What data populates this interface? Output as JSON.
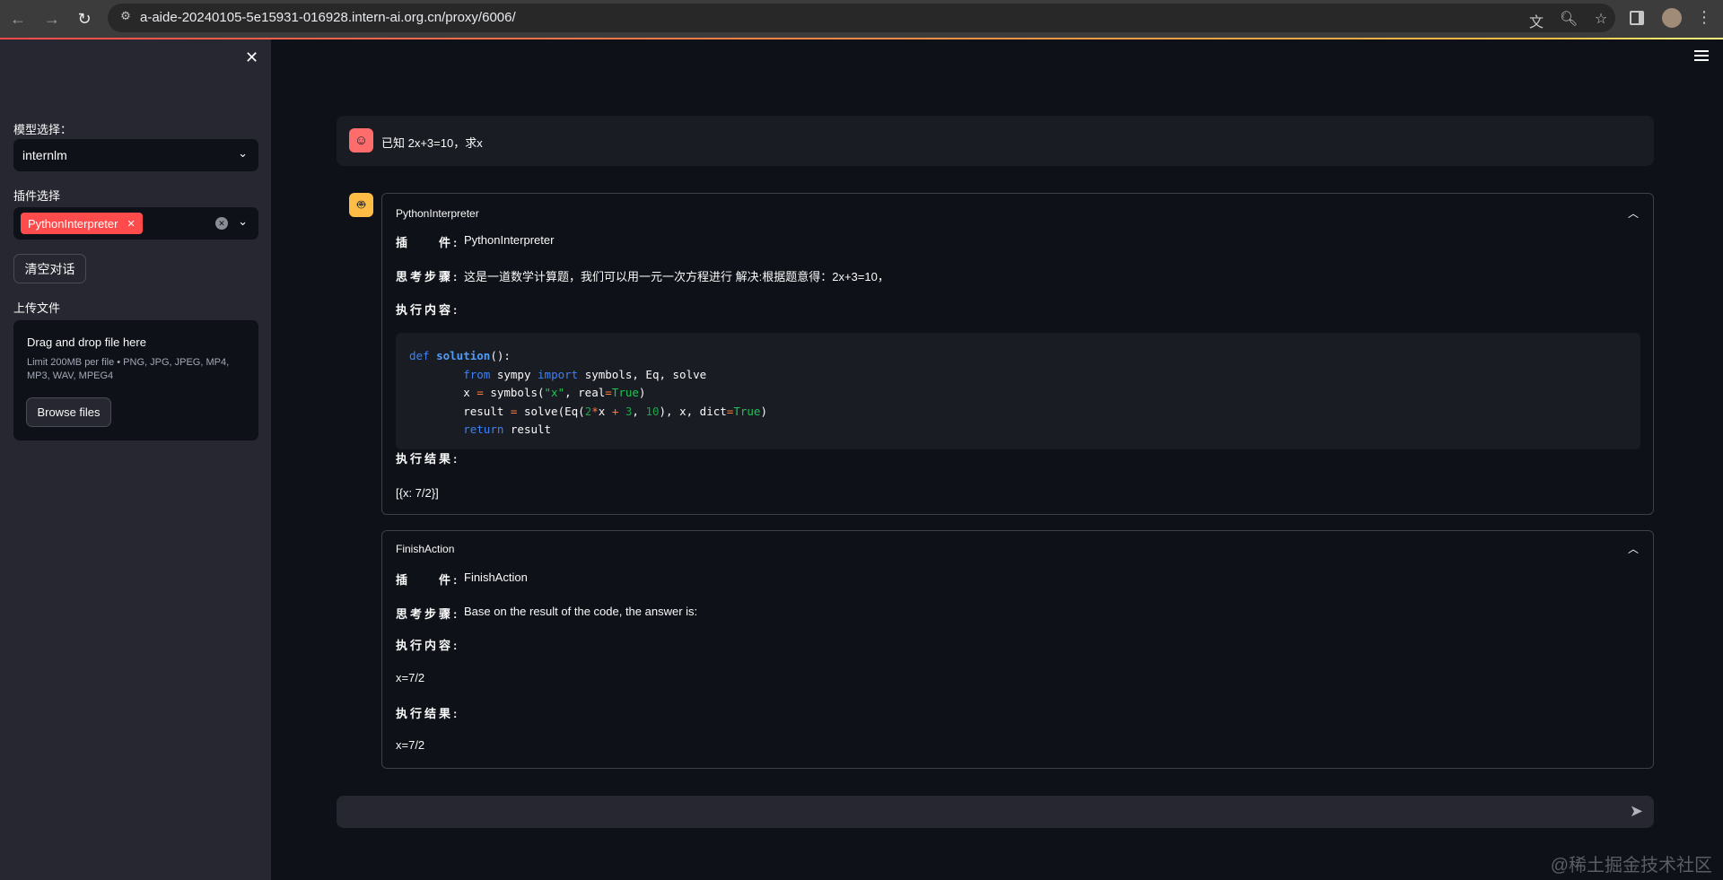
{
  "browser": {
    "url": "a-aide-20240105-5e15931-016928.intern-ai.org.cn/proxy/6006/"
  },
  "sidebar": {
    "model_label": "模型选择：",
    "model_value": "internlm",
    "plugin_label": "插件选择",
    "plugin_tags": [
      "PythonInterpreter"
    ],
    "clear_button": "清空对话",
    "upload_label": "上传文件",
    "upload": {
      "title": "Drag and drop file here",
      "limit_line1": "Limit 200MB per file • PNG, JPG, JPEG, MP4,",
      "limit_line2": "MP3, WAV, MPEG4",
      "browse_button": "Browse files"
    }
  },
  "chat": {
    "user_message": "已知 2x+3=10，求x",
    "steps": [
      {
        "title": "PythonInterpreter",
        "plugin_key": "插　　件:",
        "plugin": "PythonInterpreter",
        "thought_key": "思考步骤:",
        "thought": "这是一道数学计算题，我们可以用一元一次方程进行 解决:根据题意得：2x+3=10，",
        "action_key": "执行内容:",
        "result_key": "执行结果:",
        "result": "[{x: 7/2}]"
      },
      {
        "title": "FinishAction",
        "plugin_key": "插　　件:",
        "plugin": "FinishAction",
        "thought_key": "思考步骤:",
        "thought": "Base on the result of the code, the answer is:",
        "action_key": "执行内容:",
        "action": "x=7/2",
        "result_key": "执行结果:",
        "result": "x=7/2"
      }
    ],
    "code_lines": [
      "def solution():",
      "        from sympy import symbols, Eq, solve",
      "        x = symbols(\"x\", real=True)",
      "        result = solve(Eq(2*x + 3, 10), x, dict=True)",
      "        return result"
    ],
    "input_placeholder": ""
  },
  "watermark": "@稀土掘金技术社区"
}
